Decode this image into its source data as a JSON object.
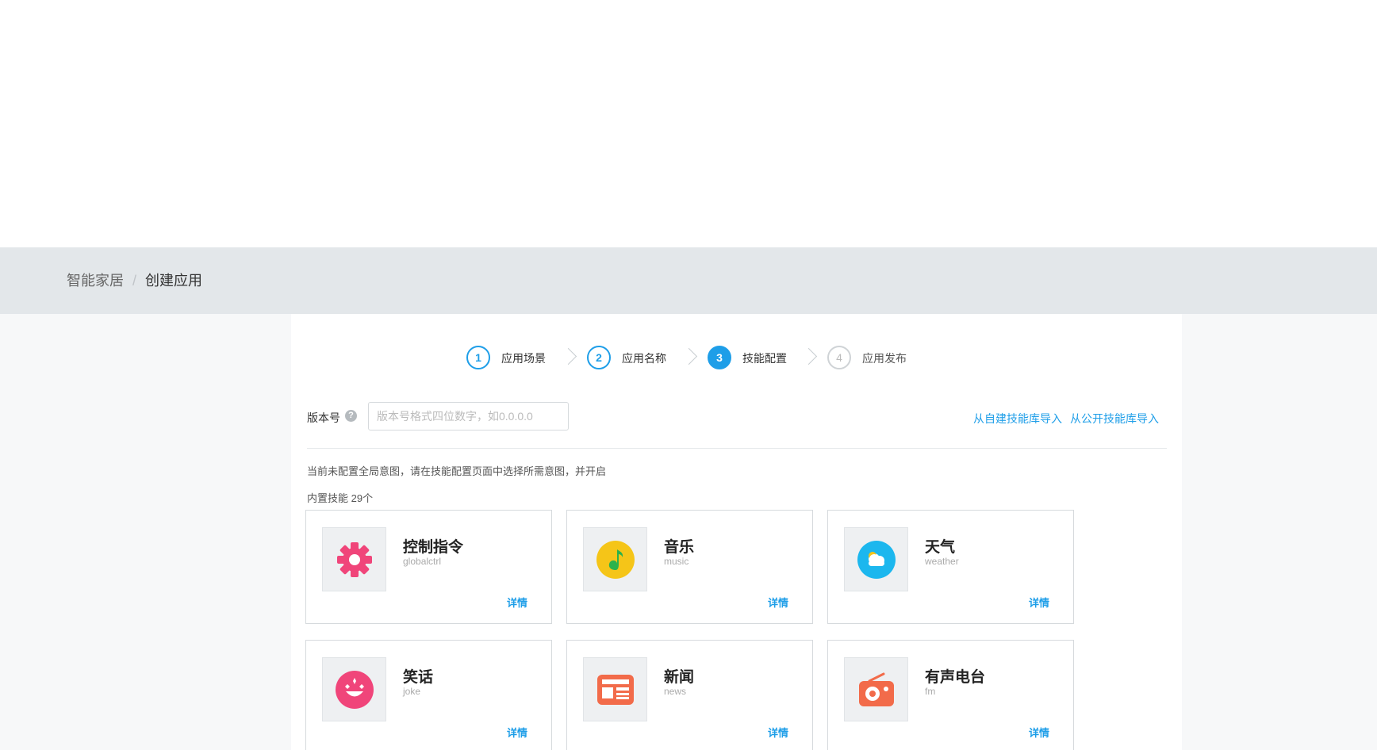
{
  "breadcrumb": {
    "parent": "智能家居",
    "separator": "/",
    "current": "创建应用"
  },
  "steps": [
    {
      "num": "1",
      "label": "应用场景",
      "state": "done"
    },
    {
      "num": "2",
      "label": "应用名称",
      "state": "done"
    },
    {
      "num": "3",
      "label": "技能配置",
      "state": "active"
    },
    {
      "num": "4",
      "label": "应用发布",
      "state": "pending"
    }
  ],
  "version": {
    "label": "版本号",
    "help": "?",
    "placeholder": "版本号格式四位数字，如0.0.0.0",
    "value": ""
  },
  "import_links": {
    "custom": "从自建技能库导入",
    "public": "从公开技能库导入"
  },
  "notice": "当前未配置全局意图，请在技能配置页面中选择所需意图，并开启",
  "builtin": {
    "label": "内置技能 29个"
  },
  "skills": [
    {
      "title": "控制指令",
      "sub": "globalctrl",
      "detail": "详情",
      "icon": "gear-icon",
      "color": "#f0457a"
    },
    {
      "title": "音乐",
      "sub": "music",
      "detail": "详情",
      "icon": "music-icon",
      "color": "#f5c518"
    },
    {
      "title": "天气",
      "sub": "weather",
      "detail": "详情",
      "icon": "weather-icon",
      "color": "#1cb7ee"
    },
    {
      "title": "笑话",
      "sub": "joke",
      "detail": "详情",
      "icon": "joke-icon",
      "color": "#f0457a"
    },
    {
      "title": "新闻",
      "sub": "news",
      "detail": "详情",
      "icon": "news-icon",
      "color": "#f26b4a"
    },
    {
      "title": "有声电台",
      "sub": "fm",
      "detail": "详情",
      "icon": "radio-icon",
      "color": "#f26b4a"
    }
  ],
  "colors": {
    "accent": "#1e9ee8",
    "bar": "#e3e7ea"
  }
}
